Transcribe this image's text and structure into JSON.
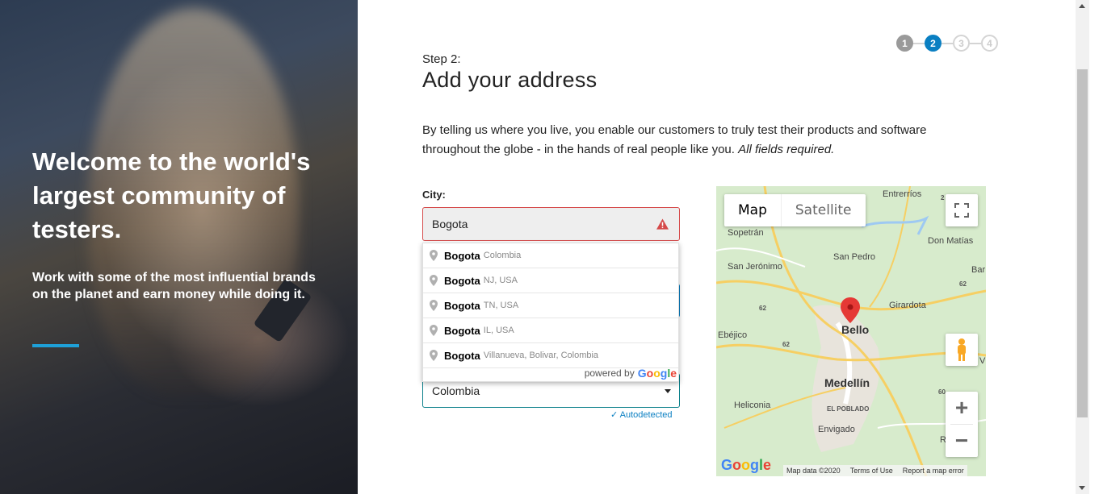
{
  "hero": {
    "title": "Welcome to the world's largest community of testers.",
    "subtitle": "Work with some of the most influential brands on the planet and earn money while doing it."
  },
  "steps": [
    "1",
    "2",
    "3",
    "4"
  ],
  "form": {
    "step_label": "Step 2:",
    "title": "Add your address",
    "intro": "By telling us where you live, you enable our customers to truly test their products and software throughout the globe - in the hands of real people like you.",
    "intro_required": "All fields required.",
    "city_label": "City:",
    "city_value": "Bogota",
    "country_value": "Colombia",
    "autodetected": "Autodetected"
  },
  "autocomplete": {
    "items": [
      {
        "main": "Bogota",
        "secondary": "Colombia"
      },
      {
        "main": "Bogota",
        "secondary": "NJ, USA"
      },
      {
        "main": "Bogota",
        "secondary": "TN, USA"
      },
      {
        "main": "Bogota",
        "secondary": "IL, USA"
      },
      {
        "main": "Bogota",
        "secondary": "Villanueva, Bolivar, Colombia"
      }
    ],
    "powered_by": "powered by",
    "logo": "Google"
  },
  "map": {
    "type_map": "Map",
    "type_satellite": "Satellite",
    "labels": {
      "entrerrios": "Entrerríos",
      "sopetran": "Sopetrán",
      "don_matias": "Don Matías",
      "san_pedro": "San Pedro",
      "san_jeronimo": "San Jerónimo",
      "bar": "Bar",
      "girardota": "Girardota",
      "ebejico": "Ebéjico",
      "bello": "Bello",
      "medellin": "Medellín",
      "el_poblado": "EL POBLADO",
      "heliconia": "Heliconia",
      "envigado": "Envigado",
      "r": "R",
      "v": "V",
      "road_62": "62",
      "road_60": "60",
      "road_2": "2"
    },
    "footer_data": "Map data ©2020",
    "footer_terms": "Terms of Use",
    "footer_report": "Report a map error",
    "logo": "Google"
  },
  "colors": {
    "accent": "#0a7fc2",
    "error": "#d54a4a",
    "hero_bar": "#1ea0d8"
  }
}
